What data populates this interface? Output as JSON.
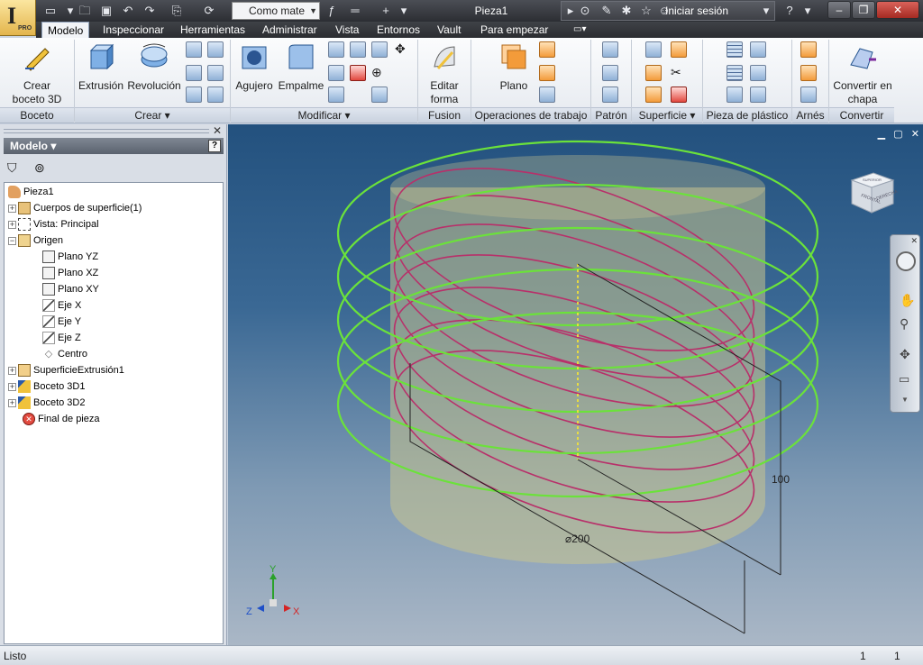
{
  "titlebar": {
    "app_edition": "PRO",
    "style_combo": "Como mate",
    "document_title": "Pieza1",
    "signin": "Iniciar sesión"
  },
  "tabs": [
    {
      "label": "Modelo"
    },
    {
      "label": "Inspeccionar"
    },
    {
      "label": "Herramientas"
    },
    {
      "label": "Administrar"
    },
    {
      "label": "Vista"
    },
    {
      "label": "Entornos"
    },
    {
      "label": "Vault"
    },
    {
      "label": "Para empezar"
    }
  ],
  "ribbon": {
    "boceto": {
      "create_sketch": "Crear",
      "create_sketch_2": "boceto 3D",
      "panel": "Boceto"
    },
    "crear": {
      "extrusion": "Extrusión",
      "revolucion": "Revolución",
      "panel": "Crear"
    },
    "modificar": {
      "agujero": "Agujero",
      "empalme": "Empalme",
      "panel": "Modificar"
    },
    "fusion": {
      "editar": "Editar",
      "editar_2": "forma",
      "panel": "Fusion"
    },
    "operaciones": {
      "plano": "Plano",
      "panel": "Operaciones de trabajo"
    },
    "patron": {
      "panel": "Patrón"
    },
    "superficie": {
      "panel": "Superficie"
    },
    "plastico": {
      "panel": "Pieza de plástico"
    },
    "arnes": {
      "panel": "Arnés"
    },
    "convertir": {
      "label": "Convertir en",
      "label_2": "chapa",
      "panel": "Convertir"
    }
  },
  "browser": {
    "title": "Modelo",
    "help": "?",
    "tree": [
      {
        "label": "Pieza1"
      },
      {
        "label": "Cuerpos de superficie(1)"
      },
      {
        "label": "Vista: Principal"
      },
      {
        "label": "Origen"
      },
      {
        "label": "Plano YZ"
      },
      {
        "label": "Plano XZ"
      },
      {
        "label": "Plano XY"
      },
      {
        "label": "Eje X"
      },
      {
        "label": "Eje Y"
      },
      {
        "label": "Eje Z"
      },
      {
        "label": "Centro"
      },
      {
        "label": "SuperficieExtrusión1"
      },
      {
        "label": "Boceto 3D1"
      },
      {
        "label": "Boceto 3D2"
      },
      {
        "label": "Final de pieza"
      }
    ]
  },
  "viewport": {
    "dim_height": "100",
    "dim_diameter": "⌀200",
    "viewcube_front": "FRONTAL",
    "viewcube_right": "DERECHA",
    "viewcube_top": "SUPERIOR",
    "triad": {
      "x": "X",
      "y": "Y",
      "z": "Z"
    }
  },
  "status": {
    "text": "Listo",
    "count1": "1",
    "count2": "1"
  },
  "colors": {
    "helix_green": "#6be23a",
    "helix_magenta": "#b8306a",
    "surface": "#c9c48e",
    "accent_tab": "#f2f4f7"
  }
}
